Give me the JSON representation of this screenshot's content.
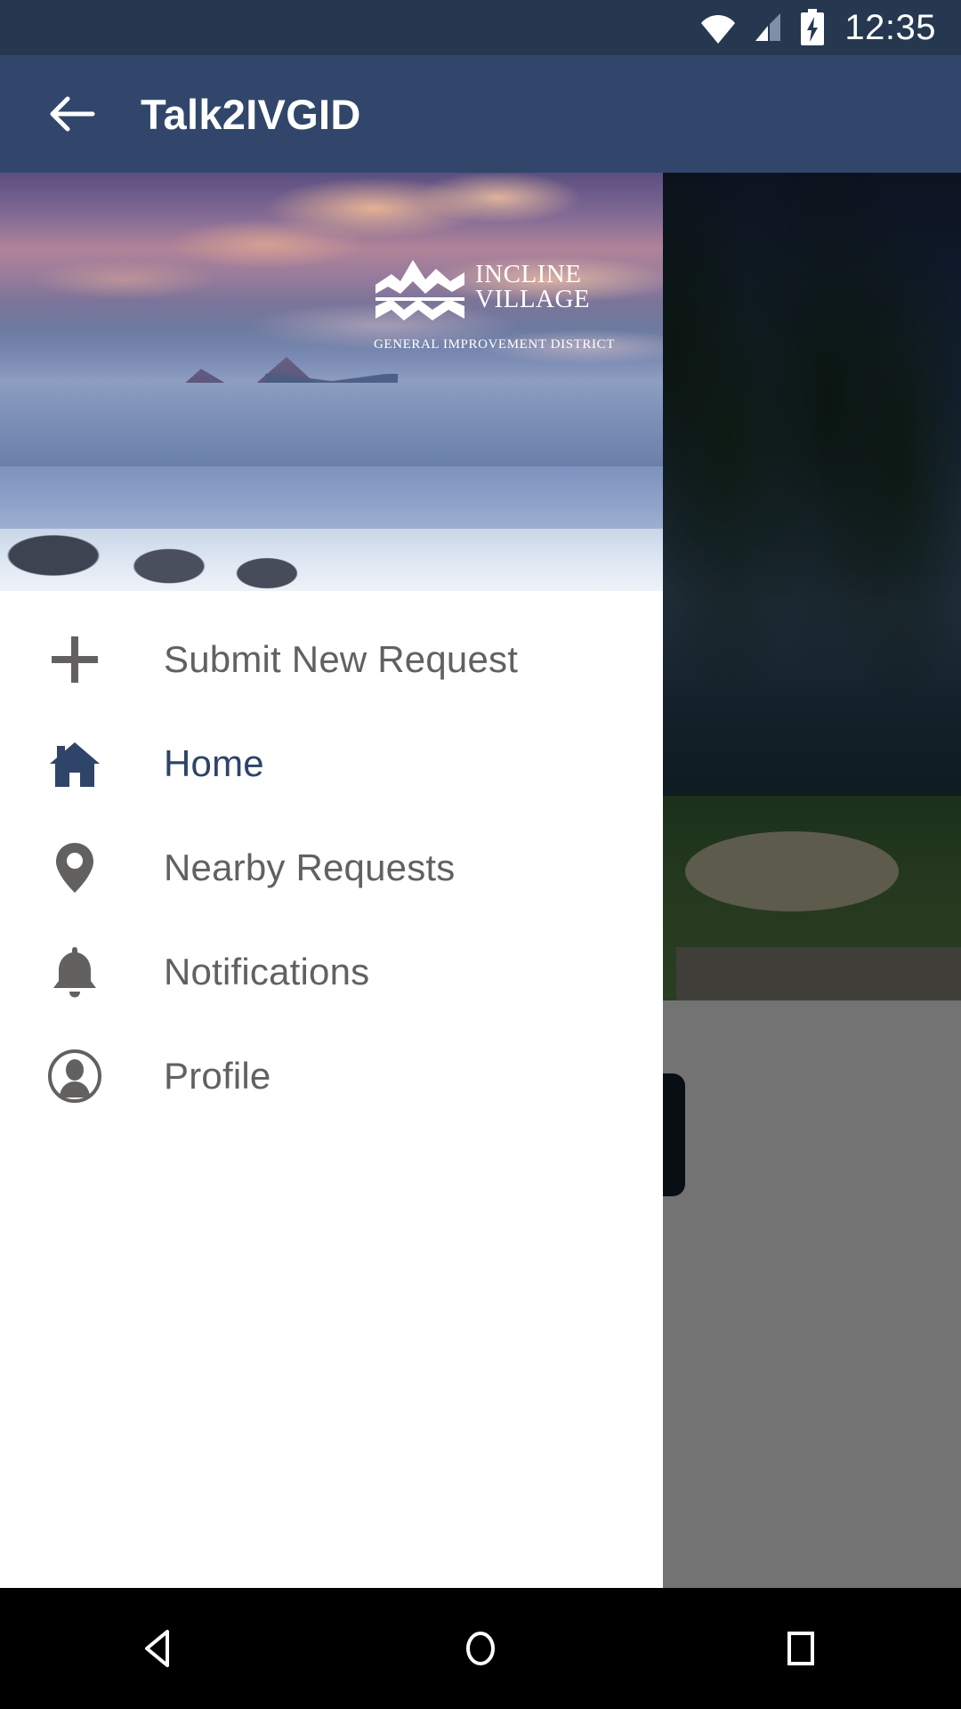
{
  "status_bar": {
    "time": "12:35",
    "icons": [
      "wifi-icon",
      "cellular-signal-icon",
      "battery-charging-icon"
    ],
    "background_color": "#25384f"
  },
  "app_bar": {
    "title": "Talk2IVGID",
    "back_icon": "back-arrow-icon",
    "background_color": "#31466a",
    "title_color": "#ffffff"
  },
  "drawer": {
    "header_image": {
      "alt": "Snowy Lake Tahoe mountain overlook at sunset",
      "logo": {
        "mark": "incline-village-mountain-wave-logo",
        "line1": "INCLINE",
        "line2": "VILLAGE",
        "subtitle": "GENERAL IMPROVEMENT DISTRICT",
        "color": "#ffffff"
      }
    },
    "menu_items": [
      {
        "id": "submit-new-request",
        "label": "Submit New Request",
        "icon": "plus-icon",
        "active": false
      },
      {
        "id": "home",
        "label": "Home",
        "icon": "home-icon",
        "active": true
      },
      {
        "id": "nearby-requests",
        "label": "Nearby Requests",
        "icon": "location-pin-icon",
        "active": false
      },
      {
        "id": "notifications",
        "label": "Notifications",
        "icon": "bell-icon",
        "active": false
      },
      {
        "id": "profile",
        "label": "Profile",
        "icon": "person-circle-icon",
        "active": false
      }
    ],
    "active_color": "#2e4468",
    "inactive_color": "#636160",
    "background_color": "#ffffff"
  },
  "background_content": {
    "description": "Forest and golf course photo partially visible behind the open navigation drawer",
    "scrim_color": "rgba(0,0,0,0.55)",
    "action_button_color": "#15202f"
  },
  "system_nav": {
    "buttons": [
      {
        "id": "back",
        "icon": "nav-back-triangle-icon"
      },
      {
        "id": "home",
        "icon": "nav-home-circle-icon"
      },
      {
        "id": "recents",
        "icon": "nav-recents-square-icon"
      }
    ],
    "background_color": "#000000"
  }
}
